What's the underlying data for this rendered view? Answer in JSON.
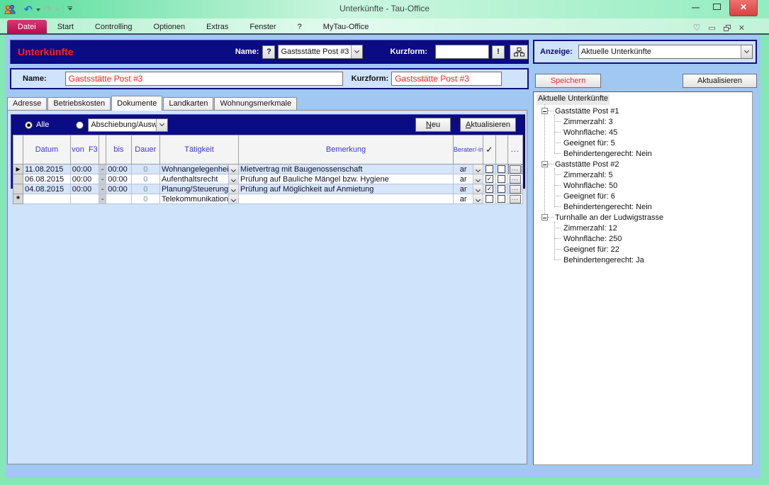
{
  "window": {
    "title": "Unterkünfte - Tau-Office"
  },
  "menu": {
    "items": [
      {
        "label": "Datei",
        "active": true
      },
      {
        "label": "Start"
      },
      {
        "label": "Controlling"
      },
      {
        "label": "Optionen"
      },
      {
        "label": "Extras"
      },
      {
        "label": "Fenster"
      },
      {
        "label": "?"
      },
      {
        "label": "MyTau-Office"
      }
    ]
  },
  "header": {
    "title": "Unterkünfte",
    "name_label": "Name:",
    "help_button": "?",
    "name_value": "Gastsstätte Post #3",
    "kurzform_label": "Kurzform:",
    "kurzform_value": "",
    "alert_button": "!"
  },
  "anzeige": {
    "label": "Anzeige:",
    "value": "Aktuelle Unterkünfte"
  },
  "form": {
    "name_label": "Name:",
    "name_value": "Gastsstätte Post #3",
    "kurzform_label": "Kurzform:",
    "kurzform_value": "Gastsstätte Post #3"
  },
  "actions": {
    "save": "Speichern",
    "refresh": "Aktualisieren"
  },
  "tabs": {
    "items": [
      "Adresse",
      "Betriebskosten",
      "Dokumente",
      "Landkarten",
      "Wohnungsmerkmale"
    ],
    "active": "Dokumente"
  },
  "filter": {
    "radio_all": "Alle",
    "combo_value": "Abschiebung/Auswei",
    "new_button": "Neu",
    "refresh_button": "Aktualisieren"
  },
  "table": {
    "columns": {
      "datum": "Datum",
      "von": "von  F3",
      "bis": "bis",
      "dauer": "Dauer",
      "taetigkeit": "Tätigkeit",
      "bemerkung": "Bemerkung",
      "berater": "Berater/-in",
      "check": "✓",
      "dots": "..."
    },
    "rows": [
      {
        "selector": "▶",
        "datum": "11.08.2015",
        "von": "00:00",
        "dash": "-",
        "bis": "00:00",
        "dauer": "0",
        "taetigkeit": "Wohnangelegenheiten",
        "bemerkung": "Mietvertrag mit Baugenossenschaft",
        "berater": "ar",
        "done": false,
        "attachment": false,
        "dots": "...",
        "focus": true,
        "new": false
      },
      {
        "selector": "",
        "datum": "06.08.2015",
        "von": "00:00",
        "dash": "-",
        "bis": "00:00",
        "dauer": "0",
        "taetigkeit": "Aufenthaltsrecht",
        "bemerkung": "Prüfung auf Bauliche Mängel bzw. Hygiene",
        "berater": "ar",
        "done": true,
        "attachment": false,
        "dots": "...",
        "focus": false,
        "new": false
      },
      {
        "selector": "",
        "datum": "04.08.2015",
        "von": "00:00",
        "dash": "-",
        "bis": "00:00",
        "dauer": "0",
        "taetigkeit": "Planung/Steuerung",
        "bemerkung": "Prüfung auf Möglichkeit auf Anmietung",
        "berater": "ar",
        "done": true,
        "attachment": false,
        "dots": "...",
        "focus": false,
        "new": false
      },
      {
        "selector": "*",
        "datum": "",
        "von": "",
        "dash": "-",
        "bis": "",
        "dauer": "0",
        "taetigkeit": "Telekommunikationen",
        "bemerkung": "",
        "berater": "ar",
        "done": false,
        "attachment": false,
        "dots": "...",
        "focus": false,
        "new": true
      }
    ]
  },
  "tree": {
    "root": "Aktuelle Unterkünfte",
    "nodes": [
      {
        "label": "Gaststätte Post #1",
        "children": [
          "Zimmerzahl: 3",
          "Wohnfläche: 45",
          "Geeignet für: 5",
          "Behindertengerecht: Nein"
        ]
      },
      {
        "label": "Gaststätte Post #2",
        "children": [
          "Zimmerzahl: 5",
          "Wohnfläche: 50",
          "Geeignet für: 6",
          "Behindertengerecht: Nein"
        ]
      },
      {
        "label": "Turnhalle an der Ludwigstrasse",
        "children": [
          "Zimmerzahl: 12",
          "Wohnfläche: 250",
          "Geeignet für: 22",
          "Behindertengerecht: Ja"
        ]
      }
    ]
  },
  "colors": {
    "accent_red": "#ff1f1f",
    "navy": "#0b0b83",
    "datei_tab": "#c2155c",
    "frame_green": "#84e8b4"
  }
}
